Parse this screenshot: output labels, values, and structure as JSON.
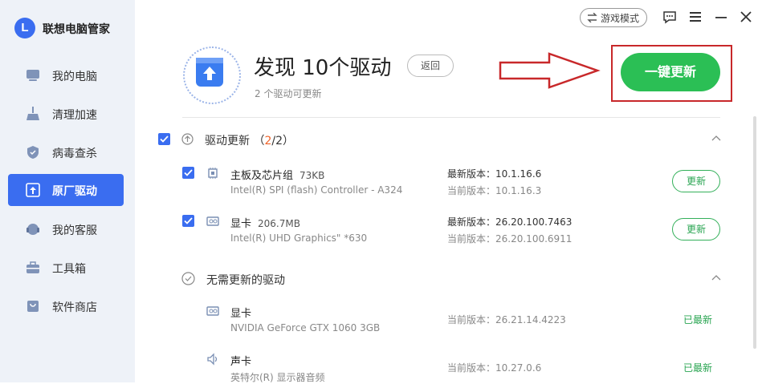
{
  "app": {
    "logo_letter": "L",
    "title": "联想电脑管家"
  },
  "sidebar": {
    "items": [
      {
        "label": "我的电脑",
        "icon": "monitor-icon"
      },
      {
        "label": "清理加速",
        "icon": "broom-icon"
      },
      {
        "label": "病毒查杀",
        "icon": "shield-icon"
      },
      {
        "label": "原厂驱动",
        "icon": "driver-upload-icon",
        "active": true
      },
      {
        "label": "我的客服",
        "icon": "headset-icon"
      },
      {
        "label": "工具箱",
        "icon": "toolbox-icon"
      },
      {
        "label": "软件商店",
        "icon": "store-bag-icon"
      }
    ]
  },
  "topbar": {
    "game_mode_label": "游戏模式"
  },
  "hero": {
    "title": "发现 10个驱动",
    "back_label": "返回",
    "subtitle": "2 个驱动可更新",
    "update_all_label": "一键更新"
  },
  "updatable": {
    "title": "驱动更新",
    "count_open": "（",
    "count_done": "2",
    "count_total": "/2）",
    "drivers": [
      {
        "name": "主板及芯片组",
        "size": "73KB",
        "desc": "Intel(R) SPI (flash) Controller - A324",
        "latest_label": "最新版本：",
        "latest": "10.1.16.6",
        "current_label": "当前版本：",
        "current": "10.1.16.3",
        "action": "更新",
        "icon": "chip-icon"
      },
      {
        "name": "显卡",
        "size": "206.7MB",
        "desc": "Intel(R) UHD Graphics\" *630",
        "latest_label": "最新版本：",
        "latest": "26.20.100.7463",
        "current_label": "当前版本：",
        "current": "26.20.100.6911",
        "action": "更新",
        "icon": "graphics-card-icon"
      }
    ]
  },
  "no_update": {
    "title": "无需更新的驱动",
    "drivers": [
      {
        "name": "显卡",
        "desc": "NVIDIA GeForce GTX 1060 3GB",
        "current_label": "当前版本：",
        "current": "26.21.14.4223",
        "status": "已最新",
        "icon": "graphics-card-icon"
      },
      {
        "name": "声卡",
        "desc": "英特尔(R) 显示器音频",
        "current_label": "当前版本：",
        "current": "10.27.0.6",
        "status": "已最新",
        "icon": "speaker-icon"
      }
    ]
  },
  "colors": {
    "accent": "#3a6df0",
    "green": "#2bbf55",
    "annotation_red": "#c8282a",
    "count_orange": "#f0642a"
  }
}
